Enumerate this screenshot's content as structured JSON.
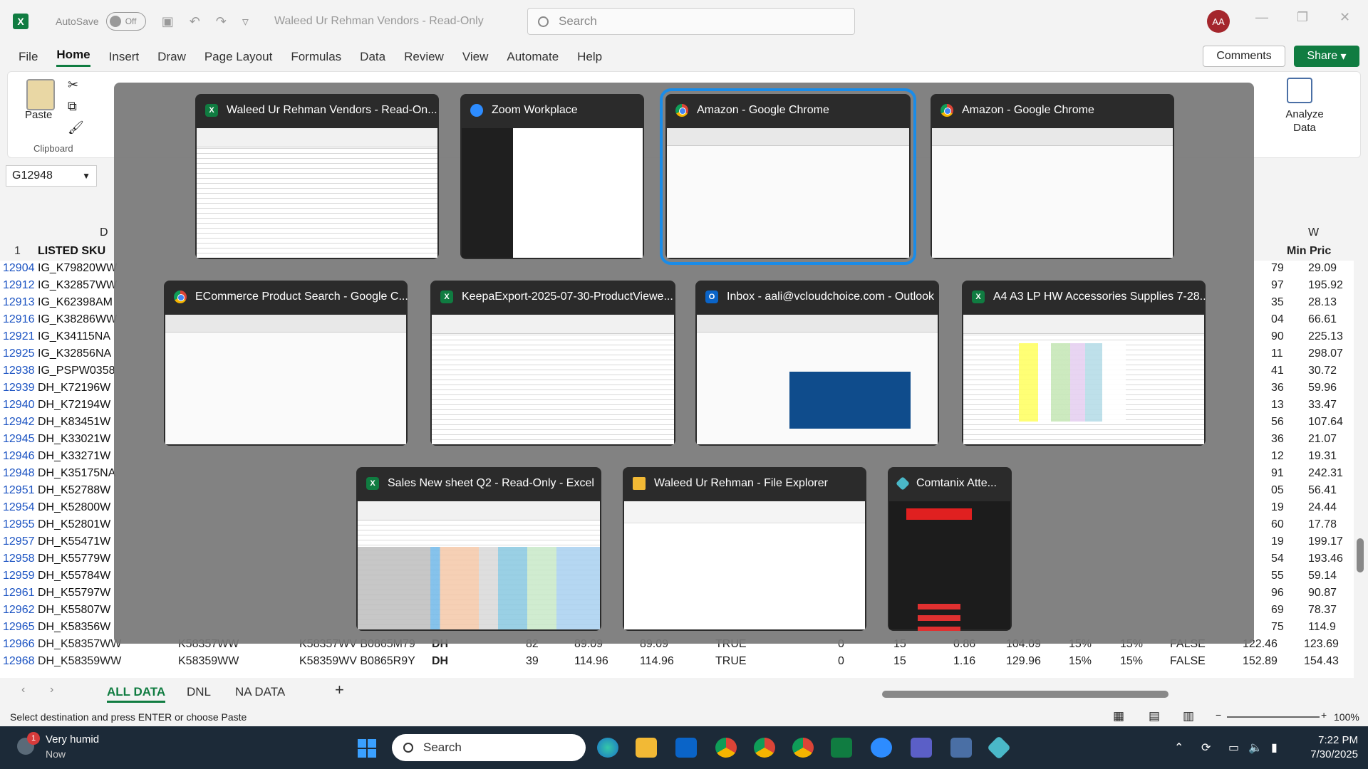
{
  "titlebar": {
    "autosave_label": "AutoSave",
    "autosave_state": "Off",
    "doc_title": "Waleed Ur Rehman Vendors - Read-Only",
    "search_placeholder": "Search",
    "user_initials": "AA"
  },
  "ribbon_tabs": [
    "File",
    "Home",
    "Insert",
    "Draw",
    "Page Layout",
    "Formulas",
    "Data",
    "Review",
    "View",
    "Automate",
    "Help"
  ],
  "active_tab": "Home",
  "actions": {
    "comments": "Comments",
    "share": "Share"
  },
  "ribbon": {
    "paste": "Paste",
    "clipboard": "Clipboard",
    "analyze": "Analyze Data"
  },
  "name_box": "G12948",
  "grid": {
    "col_d": "D",
    "col_w": "W",
    "header_row_num": "1",
    "header_sku": "LISTED SKU",
    "header_min_price": "Min Pric",
    "rows": [
      {
        "num": "12904",
        "sku": "IG_K79820WW",
        "tail": "79",
        "min": "29.09"
      },
      {
        "num": "12912",
        "sku": "IG_K32857WW",
        "tail": "97",
        "min": "195.92"
      },
      {
        "num": "12913",
        "sku": "IG_K62398AM",
        "tail": "35",
        "min": "28.13"
      },
      {
        "num": "12916",
        "sku": "IG_K38286WW",
        "tail": "04",
        "min": "66.61"
      },
      {
        "num": "12921",
        "sku": "IG_K34115NA",
        "tail": "90",
        "min": "225.13"
      },
      {
        "num": "12925",
        "sku": "IG_K32856NA",
        "tail": "11",
        "min": "298.07"
      },
      {
        "num": "12938",
        "sku": "IG_PSPW0358",
        "tail": "41",
        "min": "30.72"
      },
      {
        "num": "12939",
        "sku": "DH_K72196W",
        "tail": "36",
        "min": "59.96"
      },
      {
        "num": "12940",
        "sku": "DH_K72194W",
        "tail": "13",
        "min": "33.47"
      },
      {
        "num": "12942",
        "sku": "DH_K83451W",
        "tail": "56",
        "min": "107.64"
      },
      {
        "num": "12945",
        "sku": "DH_K33021W",
        "tail": "36",
        "min": "21.07"
      },
      {
        "num": "12946",
        "sku": "DH_K33271W",
        "tail": "12",
        "min": "19.31"
      },
      {
        "num": "12948",
        "sku": "DH_K35175NA",
        "tail": "91",
        "min": "242.31"
      },
      {
        "num": "12951",
        "sku": "DH_K52788W",
        "tail": "05",
        "min": "56.41"
      },
      {
        "num": "12954",
        "sku": "DH_K52800W",
        "tail": "19",
        "min": "24.44"
      },
      {
        "num": "12955",
        "sku": "DH_K52801W",
        "tail": "60",
        "min": "17.78"
      },
      {
        "num": "12957",
        "sku": "DH_K55471W",
        "tail": "19",
        "min": "199.17"
      },
      {
        "num": "12958",
        "sku": "DH_K55779W",
        "tail": "54",
        "min": "193.46"
      },
      {
        "num": "12959",
        "sku": "DH_K55784W",
        "tail": "55",
        "min": "59.14"
      },
      {
        "num": "12961",
        "sku": "DH_K55797W",
        "tail": "96",
        "min": "90.87"
      },
      {
        "num": "12962",
        "sku": "DH_K55807W",
        "tail": "69",
        "min": "78.37"
      },
      {
        "num": "12965",
        "sku": "DH_K58356W",
        "tail": "75",
        "min": "114.9"
      }
    ],
    "full_rows": [
      {
        "num": "12966",
        "sku": "DH_K58357WW",
        "c1": "K58357WW",
        "c2": "K58357WV B0865M79",
        "c3": "DH",
        "c4": "82",
        "c5": "89.09",
        "c6": "89.09",
        "c7": "TRUE",
        "c8": "0",
        "c9": "15",
        "c10": "0.86",
        "c11": "104.09",
        "c12": "15%",
        "c13": "15%",
        "c14": "FALSE",
        "c15": "122.46",
        "c16": "123.69"
      },
      {
        "num": "12968",
        "sku": "DH_K58359WW",
        "c1": "K58359WW",
        "c2": "K58359WV B0865R9Y",
        "c3": "DH",
        "c4": "39",
        "c5": "114.96",
        "c6": "114.96",
        "c7": "TRUE",
        "c8": "0",
        "c9": "15",
        "c10": "1.16",
        "c11": "129.96",
        "c12": "15%",
        "c13": "15%",
        "c14": "FALSE",
        "c15": "152.89",
        "c16": "154.43"
      }
    ]
  },
  "sheets": [
    "ALL DATA",
    "DNL",
    "NA DATA"
  ],
  "active_sheet": "ALL DATA",
  "status": {
    "message": "Select destination and press ENTER or choose Paste",
    "zoom": "100%"
  },
  "switcher": {
    "windows": [
      {
        "title": "Waleed Ur Rehman Vendors - Read-On...",
        "icon": "excel-icon"
      },
      {
        "title": "Zoom Workplace",
        "icon": "zoom-icon"
      },
      {
        "title": "Amazon - Google Chrome",
        "icon": "chrome-icon"
      },
      {
        "title": "Amazon - Google Chrome",
        "icon": "chrome-icon"
      },
      {
        "title": "ECommerce Product Search - Google C...",
        "icon": "chrome-icon"
      },
      {
        "title": "KeepaExport-2025-07-30-ProductViewe...",
        "icon": "excel-icon"
      },
      {
        "title": "Inbox - aali@vcloudchoice.com - Outlook",
        "icon": "outlook-icon"
      },
      {
        "title": "A4 A3 LP HW Accessories Supplies 7-28...",
        "icon": "excel-icon"
      },
      {
        "title": "Sales New sheet Q2 - Read-Only - Excel",
        "icon": "excel-icon"
      },
      {
        "title": "Waleed Ur Rehman - File Explorer",
        "icon": "folder-icon"
      },
      {
        "title": "Comtanix Atte...",
        "icon": "comtanix-icon"
      }
    ],
    "selected_index": 2
  },
  "taskbar": {
    "weather_title": "Very humid",
    "weather_sub": "Now",
    "weather_badge": "1",
    "search_label": "Search",
    "time": "7:22 PM",
    "date": "7/30/2025"
  }
}
